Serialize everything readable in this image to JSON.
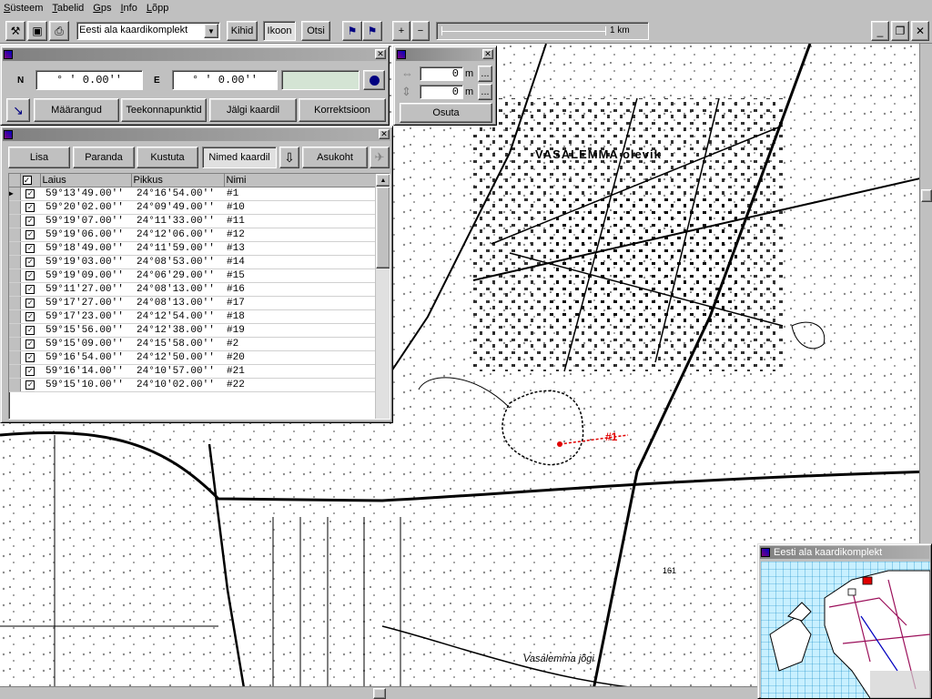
{
  "menu": [
    "Süsteem",
    "Tabelid",
    "Gps",
    "Info",
    "Lõpp"
  ],
  "menu_keys": [
    "S",
    "T",
    "G",
    "I",
    "L"
  ],
  "toolbar": {
    "map_select": "Eesti ala kaardikomplekt",
    "kihid": "Kihid",
    "ikoon": "Ikoon",
    "otsi": "Otsi",
    "plus": "+",
    "minus": "−",
    "scale": "1 km"
  },
  "coord_win": {
    "n_label": "N",
    "e_label": "E",
    "n_value": "°   '  0.00''",
    "e_value": "°   '  0.00''",
    "tabs": [
      "Määrangud",
      "Teekonnapunktid",
      "Jälgi kaardil",
      "Korrektsioon"
    ]
  },
  "offset_win": {
    "x_value": "0",
    "y_value": "0",
    "unit": "m",
    "more": "...",
    "osuta": "Osuta"
  },
  "points_win": {
    "buttons": [
      "Lisa",
      "Paranda",
      "Kustuta",
      "Nimed kaardil",
      "Asukoht"
    ],
    "columns": [
      "Laius",
      "Pikkus",
      "Nimi"
    ],
    "rows": [
      [
        "59°13'49.00''",
        "24°16'54.00''",
        "#1"
      ],
      [
        "59°20'02.00''",
        "24°09'49.00''",
        "#10"
      ],
      [
        "59°19'07.00''",
        "24°11'33.00''",
        "#11"
      ],
      [
        "59°19'06.00''",
        "24°12'06.00''",
        "#12"
      ],
      [
        "59°18'49.00''",
        "24°11'59.00''",
        "#13"
      ],
      [
        "59°19'03.00''",
        "24°08'53.00''",
        "#14"
      ],
      [
        "59°19'09.00''",
        "24°06'29.00''",
        "#15"
      ],
      [
        "59°11'27.00''",
        "24°08'13.00''",
        "#16"
      ],
      [
        "59°17'27.00''",
        "24°08'13.00''",
        "#17"
      ],
      [
        "59°17'23.00''",
        "24°12'54.00''",
        "#18"
      ],
      [
        "59°15'56.00''",
        "24°12'38.00''",
        "#19"
      ],
      [
        "59°15'09.00''",
        "24°15'58.00''",
        "#2"
      ],
      [
        "59°16'54.00''",
        "24°12'50.00''",
        "#20"
      ],
      [
        "59°16'14.00''",
        "24°10'57.00''",
        "#21"
      ],
      [
        "59°15'10.00''",
        "24°10'02.00''",
        "#22"
      ]
    ]
  },
  "map_labels": {
    "town": "VASALEMMA olevik",
    "river": "Vasalemma jõgi",
    "marker": "#1",
    "height": "161"
  },
  "overview": {
    "title": "Eesti ala kaardikomplekt"
  }
}
